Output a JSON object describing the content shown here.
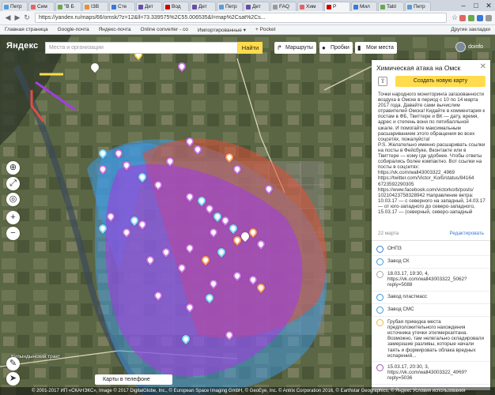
{
  "browser": {
    "tabs": [
      {
        "label": "Петр",
        "color": "#5b9bd5",
        "active": false
      },
      {
        "label": "Сим",
        "color": "#e06666",
        "active": false
      },
      {
        "label": "\"В Б",
        "color": "#6aa84f",
        "active": false
      },
      {
        "label": "ІЗВ",
        "color": "#e69138",
        "active": false
      },
      {
        "label": "Сте",
        "color": "#3c78d8",
        "active": false
      },
      {
        "label": "Дет",
        "color": "#674ea7",
        "active": false
      },
      {
        "label": "Вод",
        "color": "#cc0000",
        "active": false
      },
      {
        "label": "Дет",
        "color": "#674ea7",
        "active": false
      },
      {
        "label": "Петр",
        "color": "#5b9bd5",
        "active": false
      },
      {
        "label": "Дет",
        "color": "#674ea7",
        "active": false
      },
      {
        "label": "FAQ",
        "color": "#999999",
        "active": false
      },
      {
        "label": "Хим",
        "color": "#e06666",
        "active": false
      },
      {
        "label": "Р",
        "color": "#cc0000",
        "active": true
      },
      {
        "label": "Мил",
        "color": "#3c78d8",
        "active": false
      },
      {
        "label": "Tabl",
        "color": "#6aa84f",
        "active": false
      },
      {
        "label": "Петр",
        "color": "#5b9bd5",
        "active": false
      }
    ],
    "window_controls": [
      "–",
      "□",
      "✕"
    ],
    "url": "https://yandex.ru/maps/66/omsk/?z=12&ll=73.339575%2C55.006535&l=map%2Csat%2Cs...",
    "bookmarks": [
      "Главная страница",
      "Google-почта",
      "Яндекс-почта",
      "Online converter - co",
      "Импортированные ▾",
      "+ Pocket"
    ],
    "bookmarks_right": "Другие закладки"
  },
  "yandex": {
    "logo": "Яндекс",
    "search_placeholder": "Места и организации",
    "find_button": "Найти",
    "routes_button": "Маршруты",
    "traffic_button": "Пробки",
    "my_places_button": "Мои места",
    "username": "doinfo"
  },
  "map_controls": [
    "⊕",
    "⤢",
    "◎",
    "➤",
    "+",
    "−"
  ],
  "panel": {
    "title": "Химическая атака на Омск",
    "create_button": "Создать новую карту",
    "description": "Точки народного мониторинга загазованности воздуха в Омске в период с 10 по 14 марта 2017 года. Давайте сами вычислим отравителей Омска! Кидайте в комментария к постам в ФБ, Твиттере и ВК — дату, время, адрес и степень вони по пятибалльной шкале. И помогайте максимальным расшариванием этого обращения во всех соцсетях, пожалуйста!\nP.S. Желательно именно расшаривать ссылки на посты в Фейсбуке, Вконтакте или в Твиттере — кому где удобнее. Чтобы ответы собирались более компактно. Вот ссылки на посты в соцсетях:\nhttps://vk.com/wall43003322_4969\nhttps://twitter.com/Victor_Korb/status/84164 6723592290305\nhttps://www.facebook.com/victorkorb/posts/ 10210423758328942 Направление ветра: 10.03.17 — с северного на западный, 14.03.17 — от юго-западного до северо-западного, 15.03.17 — (северный, северо-западный",
    "date": "22 марта",
    "edit_link": "Редактировать",
    "items": [
      {
        "text": "ОНПЗ",
        "color": "#3a7bd5"
      },
      {
        "text": "Завод СК",
        "color": "#3a9bdc"
      },
      {
        "text": "18.03.17, 19:30, 4, https://vk.com/wall43003322_5062?reply=5088",
        "color": "#aaaaaa"
      },
      {
        "text": "Завод пластмасс",
        "color": "#3a9bdc"
      },
      {
        "text": "Завод СМС",
        "color": "#3a9bdc"
      },
      {
        "text": "Грубая прикидка места предположительного нахождения источника утечки этилмеркаптана. Возможно, там нелегально складировали замерзшие разливы, которые начали таять и формировать облака вредных испарений...",
        "color": "#e8b93b"
      },
      {
        "text": "15.03.17, 20:30, 3, https://vk.com/wall43003322_4969?reply=5036",
        "color": "#9b59b6"
      }
    ]
  },
  "bottom": {
    "phone_button": "Карты в телефоне",
    "copyright": "© 2001-2017 ИП «СКАНЭКС», Image © 2017 DigitalGlobe, Inc., © European Space Imaging GmbH, © GeoEye, Inc. © Antrix Corporation 2016, © Earthstar Geographics, © Яндекс   Условия использования",
    "scale": "2 км"
  },
  "map_labels": {
    "road": "Кулындынский тракт"
  },
  "colors": {
    "blue_zone": "#3d9be9",
    "purple_zone": "#a040e0",
    "red_zone": "#e0503a",
    "yellow": "#ffdb4d"
  }
}
